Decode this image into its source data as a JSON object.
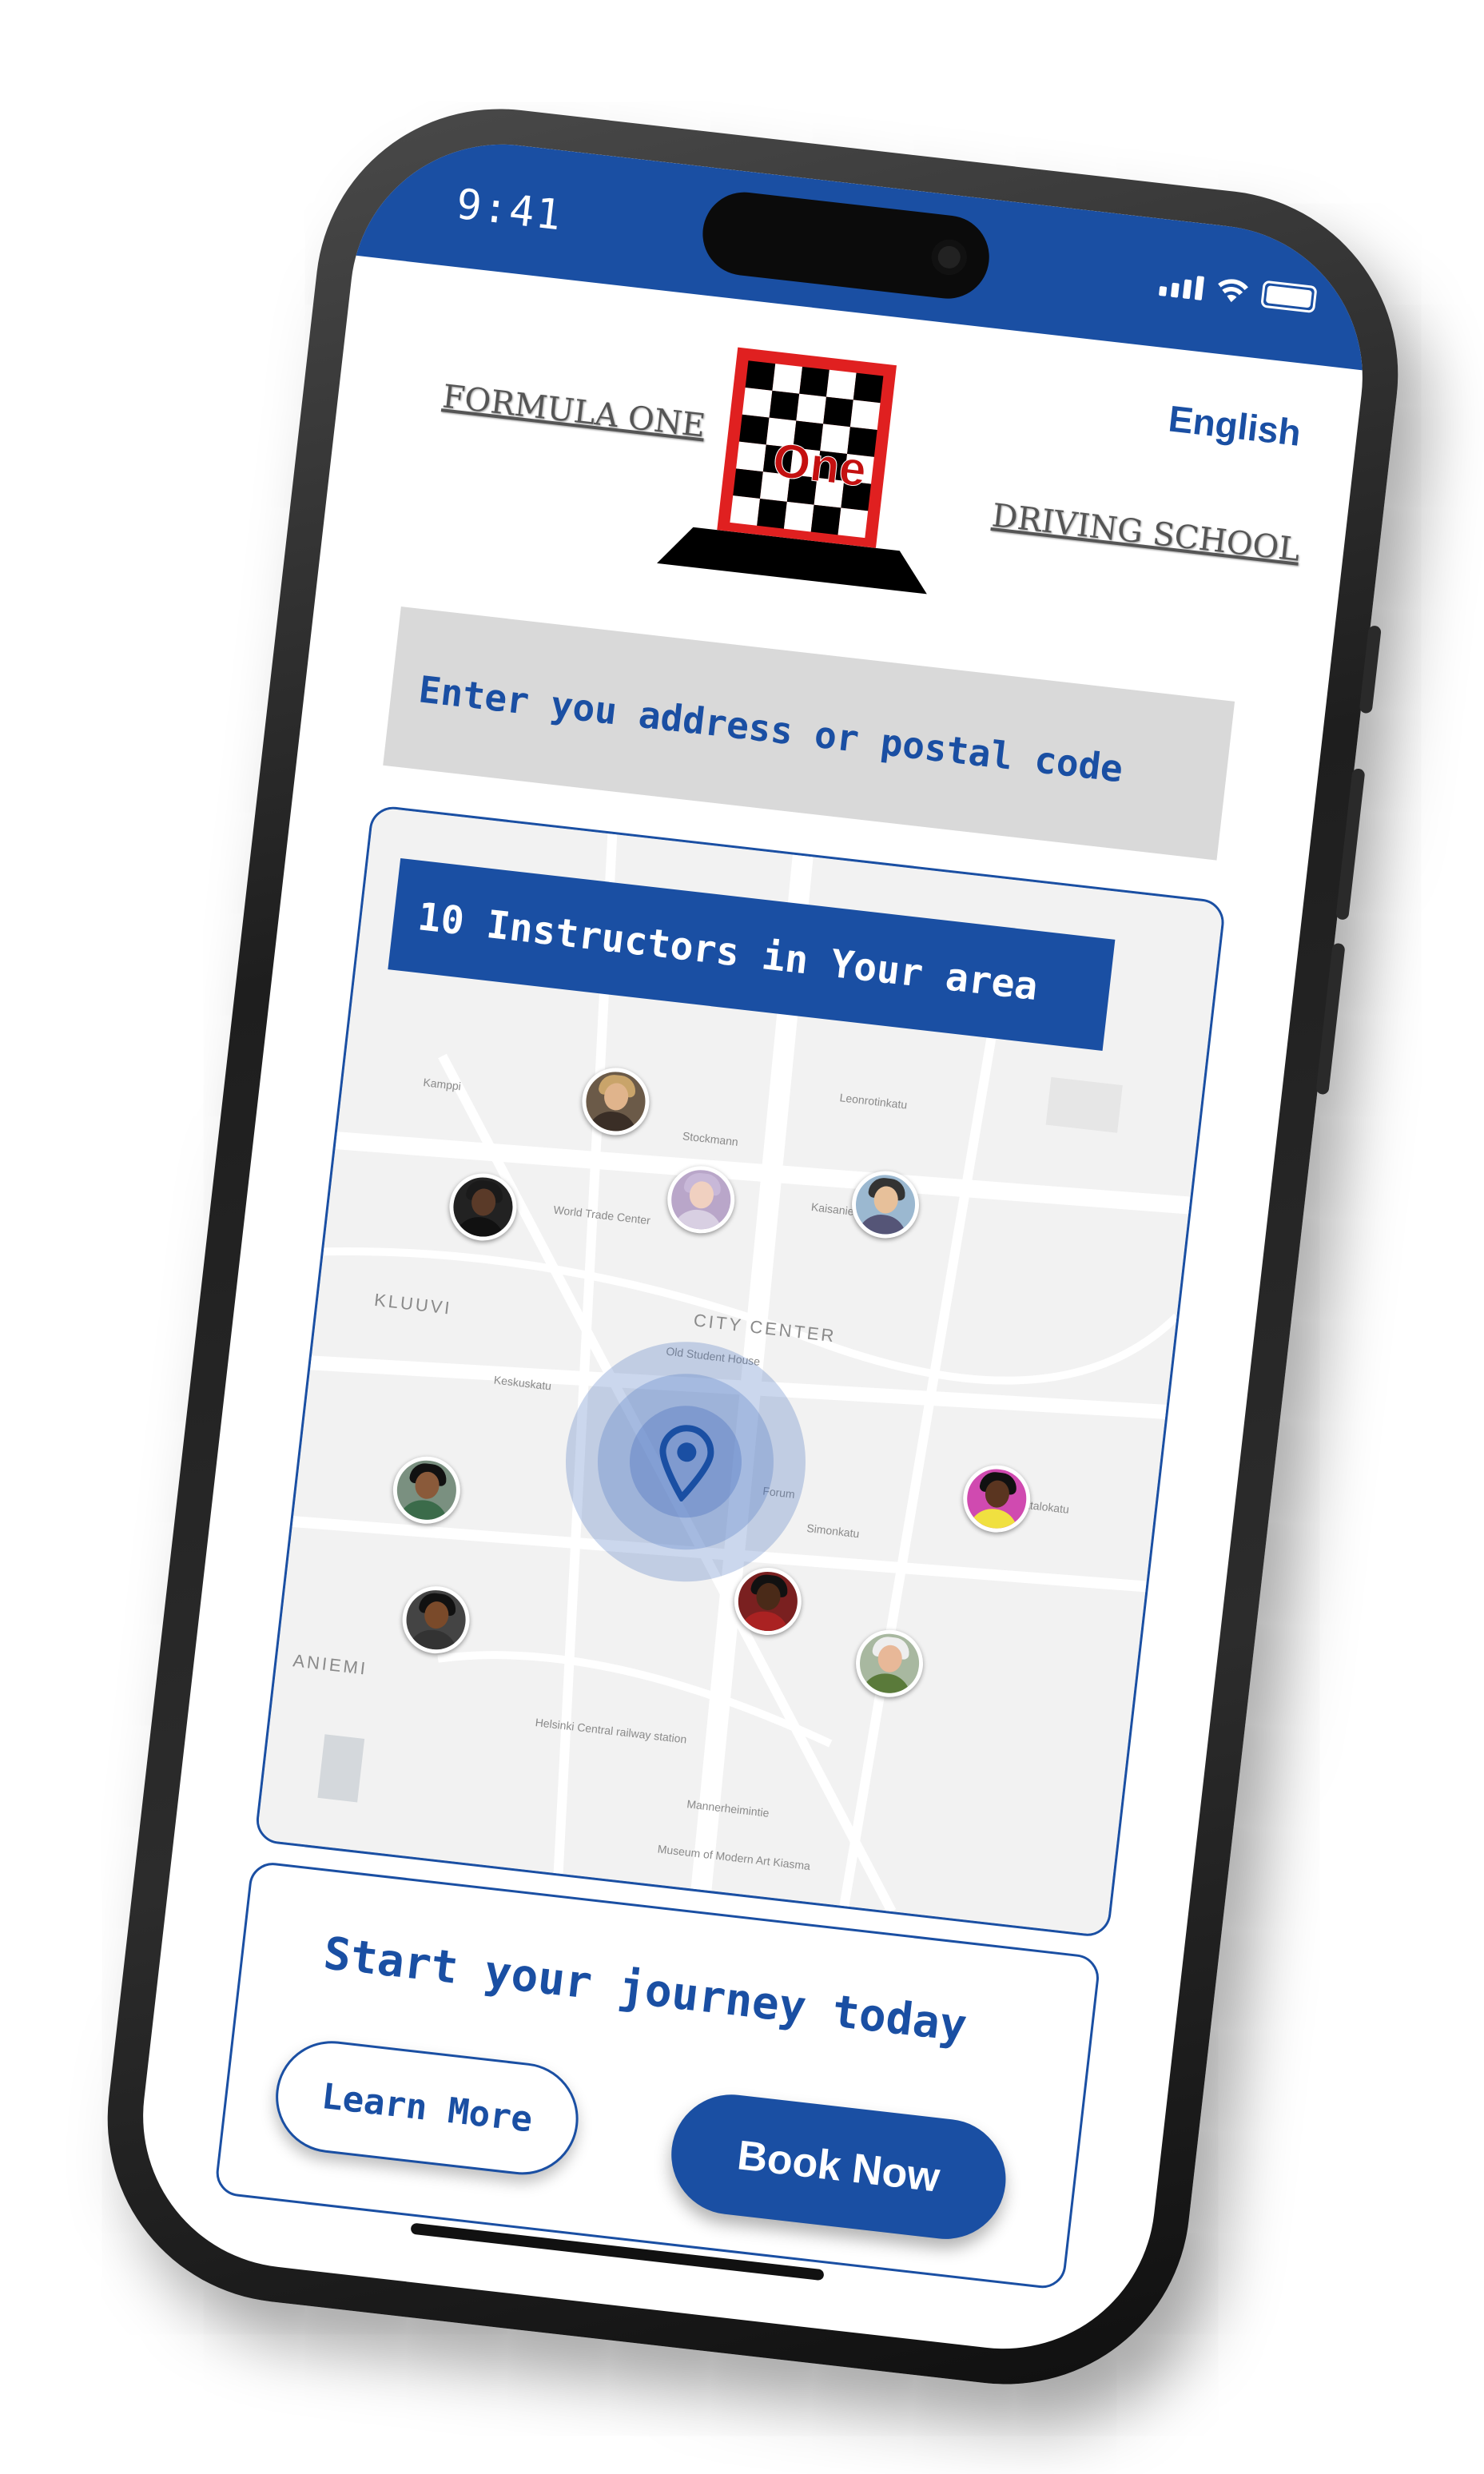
{
  "status_bar": {
    "time": "9:41"
  },
  "header": {
    "brand_left": "FORMULA ONE",
    "brand_right": "DRIVING SCHOOL",
    "logo_text": "One",
    "language": "English"
  },
  "search": {
    "placeholder": "Enter you address or postal code"
  },
  "map": {
    "instructor_banner": "10 Instructors in Your area",
    "labels": {
      "district_1": "KLUUVI",
      "district_2": "CITY CENTER",
      "district_3": "ANIEMI",
      "street_1": "Leonrotinkatu",
      "street_2": "Keskuskatu",
      "street_3": "Kaisaniemenkatu",
      "street_4": "Simonkatu",
      "street_5": "Kanakkatalokatu",
      "street_6": "Mannerheimintie",
      "poi_1": "World Trade Center",
      "poi_2": "Old Student House",
      "poi_3": "Helsinki Central railway station",
      "poi_4": "Museum of Modern Art Kiasma",
      "poi_5": "Stockmann",
      "poi_6": "Forum",
      "poi_7": "Kamppi"
    },
    "instructors": [
      {
        "name": "instructor-1"
      },
      {
        "name": "instructor-2"
      },
      {
        "name": "instructor-3"
      },
      {
        "name": "instructor-4"
      },
      {
        "name": "instructor-5"
      },
      {
        "name": "instructor-6"
      },
      {
        "name": "instructor-7"
      },
      {
        "name": "instructor-8"
      },
      {
        "name": "instructor-9"
      },
      {
        "name": "instructor-10"
      }
    ]
  },
  "cta": {
    "title": "Start your journey today",
    "learn_more": "Learn More",
    "book_now": "Book Now"
  },
  "colors": {
    "accent": "#1a4fa3",
    "field_bg": "#d9d9d9",
    "logo_red": "#e02020"
  },
  "icons": [
    "wifi-icon",
    "signal-icon",
    "battery-icon",
    "location-pin-icon",
    "camera-icon"
  ]
}
